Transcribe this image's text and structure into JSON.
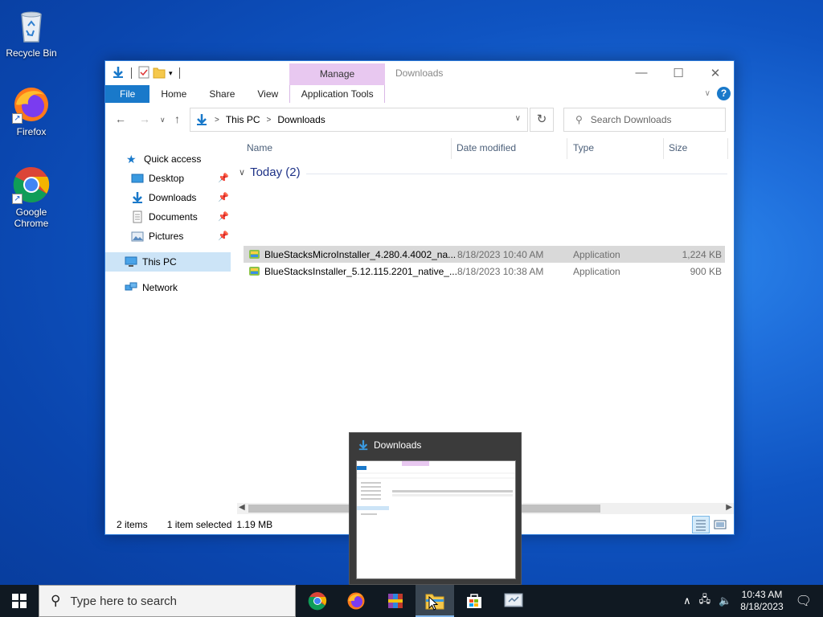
{
  "desktop": {
    "icons": [
      {
        "label": "Recycle Bin"
      },
      {
        "label": "Firefox"
      },
      {
        "label": "Google Chrome"
      }
    ]
  },
  "window": {
    "title": "Downloads",
    "context_tab": "Manage",
    "ribbon_tabs": [
      "File",
      "Home",
      "Share",
      "View",
      "Application Tools"
    ],
    "address": {
      "crumbs": [
        "This PC",
        "Downloads"
      ]
    },
    "search_placeholder": "Search Downloads",
    "nav": {
      "quick_access": "Quick access",
      "items": [
        "Desktop",
        "Downloads",
        "Documents",
        "Pictures"
      ],
      "this_pc": "This PC",
      "network": "Network"
    },
    "columns": [
      "Name",
      "Date modified",
      "Type",
      "Size"
    ],
    "group_label": "Today (2)",
    "files": [
      {
        "name": "BlueStacksMicroInstaller_4.280.4.4002_na...",
        "date": "8/18/2023 10:40 AM",
        "type": "Application",
        "size": "1,224 KB",
        "selected": true
      },
      {
        "name": "BlueStacksInstaller_5.12.115.2201_native_...",
        "date": "8/18/2023 10:38 AM",
        "type": "Application",
        "size": "900 KB",
        "selected": false
      }
    ],
    "status": {
      "items": "2 items",
      "selected": "1 item selected",
      "size": "1.19 MB"
    }
  },
  "thumbnail": {
    "title": "Downloads"
  },
  "taskbar": {
    "search_placeholder": "Type here to search",
    "apps": [
      "chrome-icon",
      "firefox-icon",
      "winrar-icon",
      "file-explorer-icon",
      "store-icon",
      "settings-app-icon"
    ],
    "clock": {
      "time": "10:43 AM",
      "date": "8/18/2023"
    }
  },
  "colors": {
    "accent": "#1979ca",
    "manage_tab": "#e8c8f0",
    "selection": "#d9d9d9",
    "taskbar": "#101922"
  }
}
